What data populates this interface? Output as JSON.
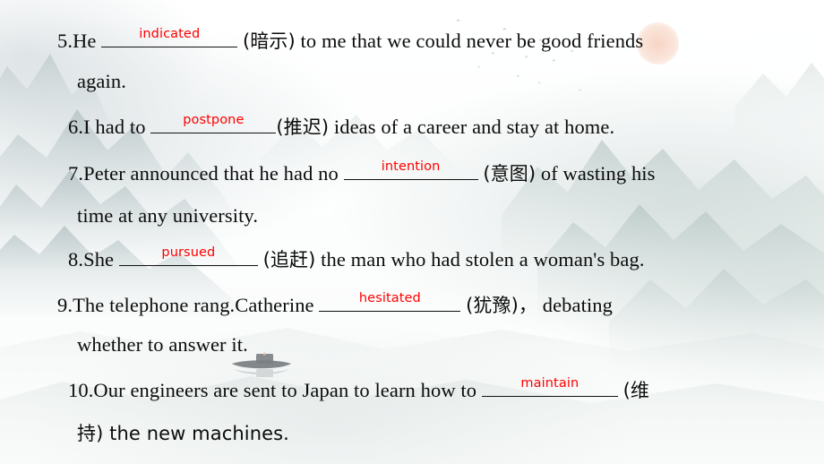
{
  "slide": {
    "background_theme": "chinese-ink-wash-landscape",
    "text_color": "#0b0b0b",
    "answer_color": "#fe0000",
    "sun_color": "#f3b9a0",
    "mountain_color": "#aebcbd"
  },
  "exercises": [
    {
      "number": "5.He",
      "answer": "indicated",
      "hint": "(暗示)",
      "after": "to me that we could never be good friends",
      "continuation": "again."
    },
    {
      "number": "6.I had to",
      "answer": "postpone",
      "hint": "(推迟)",
      "after": "ideas of a career and stay at home.",
      "continuation": ""
    },
    {
      "number": "7.Peter announced that he had no",
      "answer": "intention",
      "hint": "(意图)",
      "after": "of wasting his",
      "continuation": "time at any university."
    },
    {
      "number": "8.She",
      "answer": "pursued",
      "hint": "(追赶)",
      "after": "the man who had stolen a woman's bag.",
      "continuation": ""
    },
    {
      "number": "9.The telephone rang.Catherine",
      "answer": "hesitated",
      "hint": "(犹豫)，",
      "after": "debating",
      "continuation": "whether to answer it."
    },
    {
      "number": "10.Our engineers are sent to Japan to learn how to",
      "answer": "maintain",
      "hint": "(维",
      "after": "",
      "continuation": "持) the new machines."
    }
  ],
  "decor": {
    "sun_label": "sun-disc",
    "boat_label": "fishing-boat",
    "birds_label": "flying-birds"
  }
}
